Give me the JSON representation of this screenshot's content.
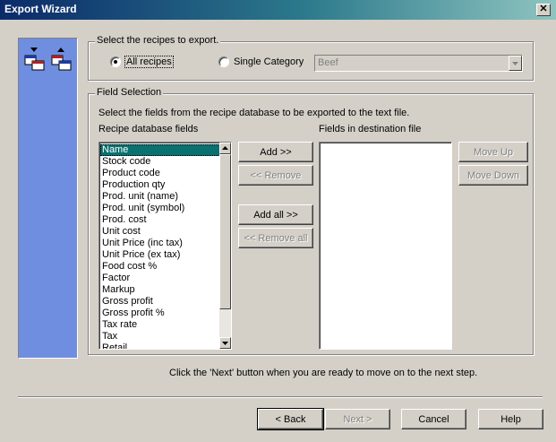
{
  "window": {
    "title": "Export Wizard",
    "close_glyph": "✕"
  },
  "recipes_group": {
    "label": "Select the recipes to export.",
    "all_recipes": "All recipes",
    "single_category": "Single Category",
    "category_value": "Beef"
  },
  "field_group": {
    "label": "Field Selection",
    "instructions": "Select the fields from the recipe database to be exported to the text file.",
    "source_header": "Recipe database fields",
    "dest_header": "Fields in destination file",
    "source_fields": [
      "Name",
      "Stock code",
      "Product code",
      "Production qty",
      "Prod. unit (name)",
      "Prod. unit (symbol)",
      "Prod. cost",
      "Unit cost",
      "Unit Price (inc tax)",
      "Unit Price (ex tax)",
      "Food cost %",
      "Factor",
      "Markup",
      "Gross profit",
      "Gross profit %",
      "Tax rate",
      "Tax",
      "Retail"
    ],
    "add_label": "Add >>",
    "remove_label": "<< Remove",
    "add_all_label": "Add all >>",
    "remove_all_label": "<< Remove all",
    "move_up_label": "Move Up",
    "move_down_label": "Move Down"
  },
  "footer": {
    "hint": "Click the 'Next' button when you are ready to move on to the next step.",
    "back_label": "< Back",
    "next_label": "Next >",
    "cancel_label": "Cancel",
    "help_label": "Help"
  },
  "icons": [
    "export-down-icon",
    "export-up-icon",
    "chevron-down-icon",
    "scroll-up-icon",
    "scroll-down-icon"
  ]
}
